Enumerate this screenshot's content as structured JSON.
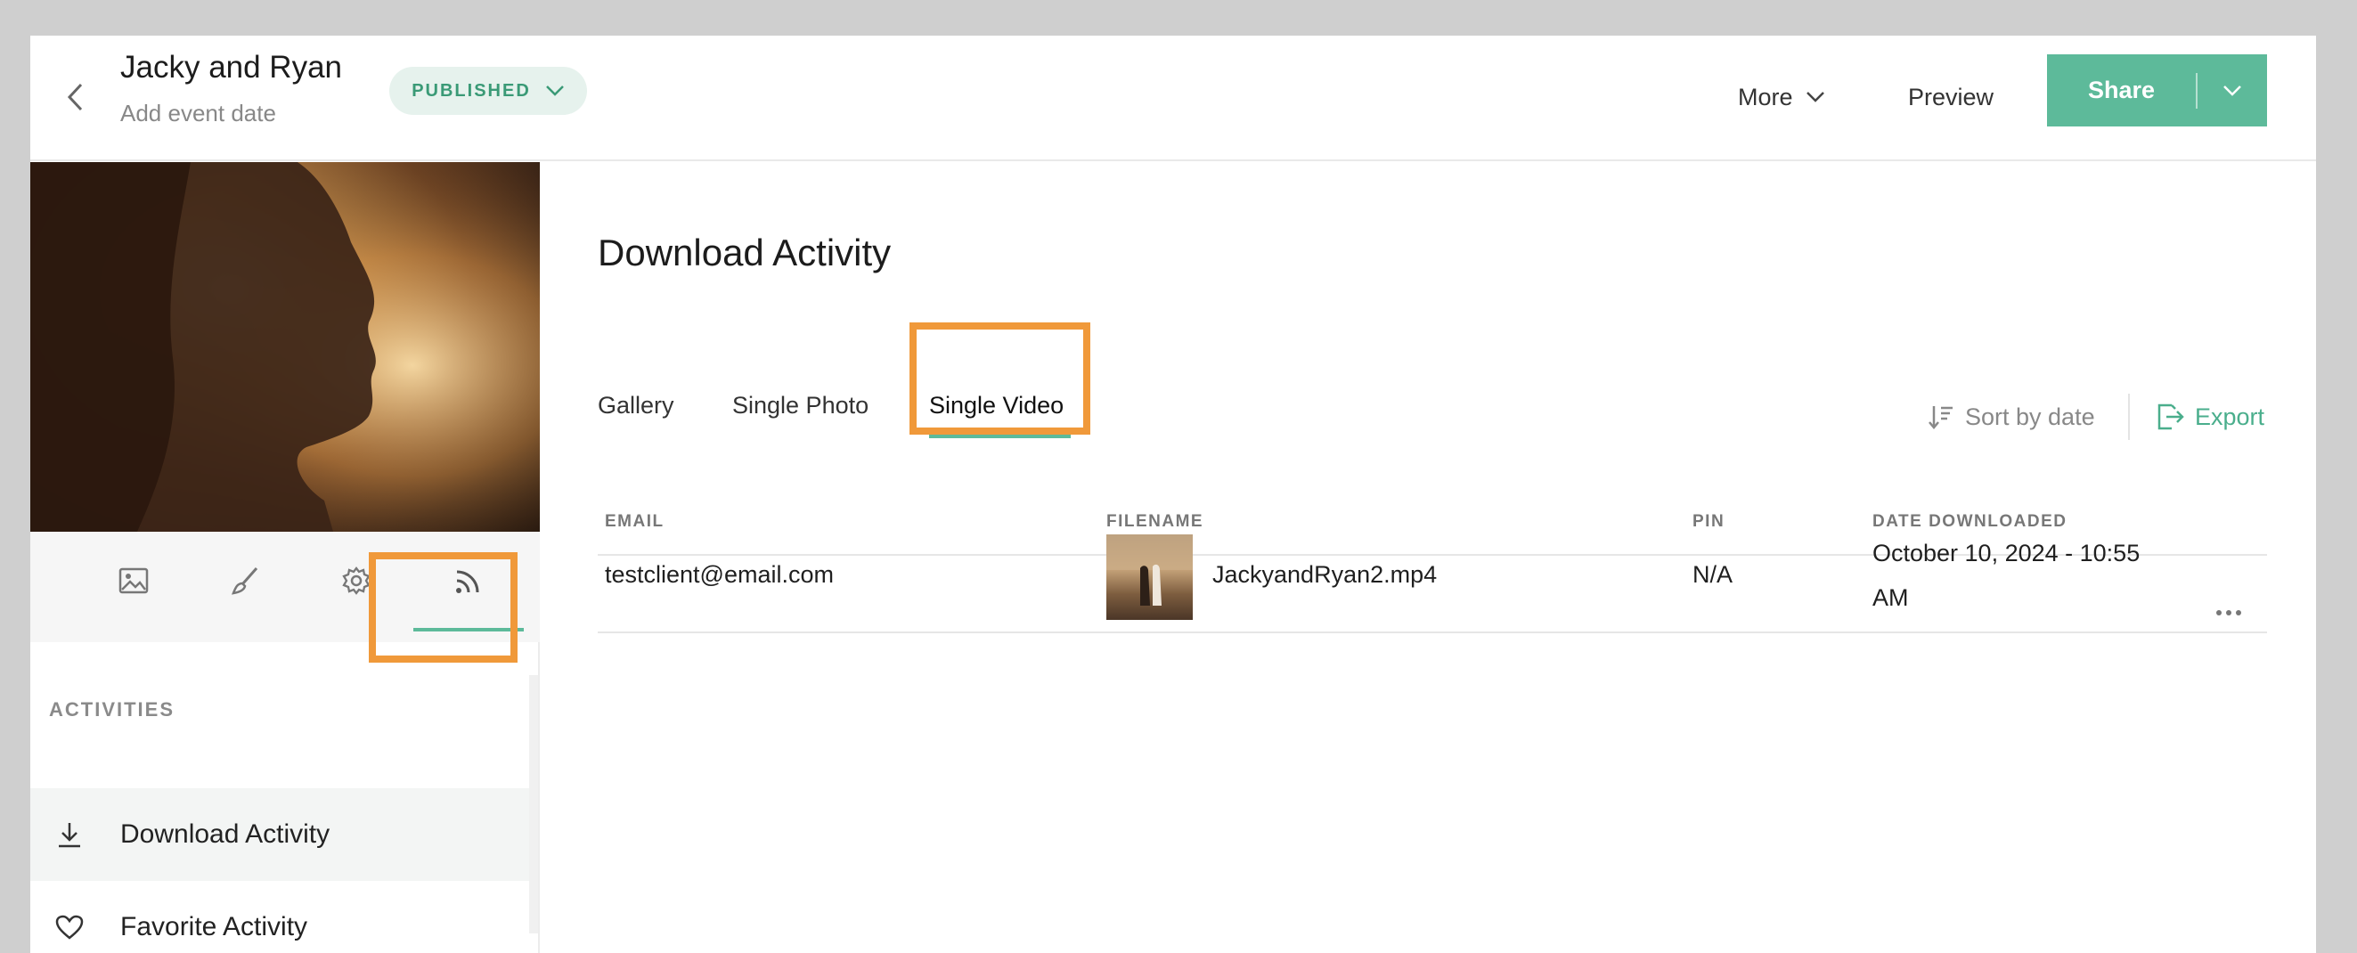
{
  "header": {
    "title": "Jacky and Ryan",
    "subtitle": "Add event date",
    "status": "PUBLISHED",
    "more_label": "More",
    "preview_label": "Preview",
    "share_label": "Share"
  },
  "sidebar": {
    "icon_tabs": [
      "photos-icon",
      "design-icon",
      "settings-icon",
      "activity-feed-icon"
    ],
    "active_icon_tab": "activity-feed-icon",
    "section_label": "ACTIVITIES",
    "items": [
      {
        "label": "Download Activity",
        "icon": "download-icon",
        "active": true
      },
      {
        "label": "Favorite Activity",
        "icon": "heart-icon",
        "active": false
      }
    ]
  },
  "main": {
    "title": "Download Activity",
    "tabs": [
      {
        "label": "Gallery",
        "active": false
      },
      {
        "label": "Single Photo",
        "active": false
      },
      {
        "label": "Single Video",
        "active": true
      }
    ],
    "sort_label": "Sort by date",
    "export_label": "Export",
    "table": {
      "columns": [
        "EMAIL",
        "FILENAME",
        "PIN",
        "DATE DOWNLOADED"
      ],
      "rows": [
        {
          "email": "testclient@email.com",
          "filename": "JackyandRyan2.mp4",
          "pin": "N/A",
          "date_line1": "October 10, 2024 - 10:55",
          "date_line2": "AM"
        }
      ]
    }
  },
  "colors": {
    "accent": "#5dba9a",
    "highlight": "#f0993a",
    "status_bg": "#e6f2ed"
  }
}
